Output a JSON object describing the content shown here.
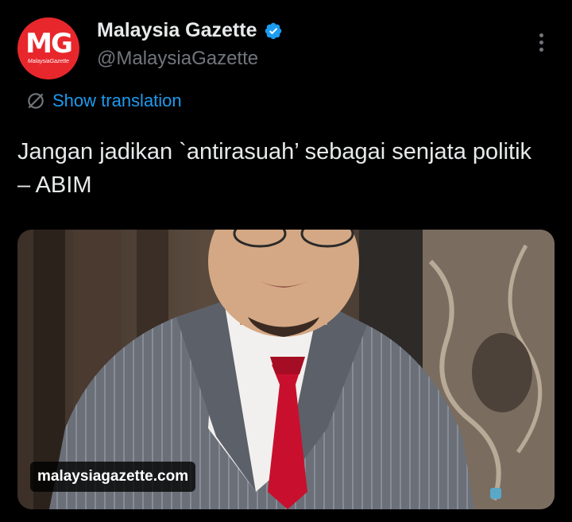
{
  "account": {
    "avatar_text": "MG",
    "avatar_subtext": "MalaysiaGazette",
    "display_name": "Malaysia Gazette",
    "handle": "@MalaysiaGazette",
    "verified": true,
    "avatar_color": "#e8272c"
  },
  "actions": {
    "more_icon": "more-vertical-icon",
    "translation_icon": "globe-icon",
    "show_translation_label": "Show translation"
  },
  "tweet": {
    "text": "Jangan jadikan `antirasuah’ sebagai senjata politik – ABIM"
  },
  "media": {
    "link_label": "malaysiagazette.com",
    "description_icon": "photo-of-man-in-suit"
  },
  "colors": {
    "background": "#000000",
    "text_primary": "#e7e9ea",
    "text_secondary": "#71767b",
    "link_blue": "#1d9bf0",
    "verified_blue": "#1d9bf0",
    "tie_red": "#c8102e"
  }
}
